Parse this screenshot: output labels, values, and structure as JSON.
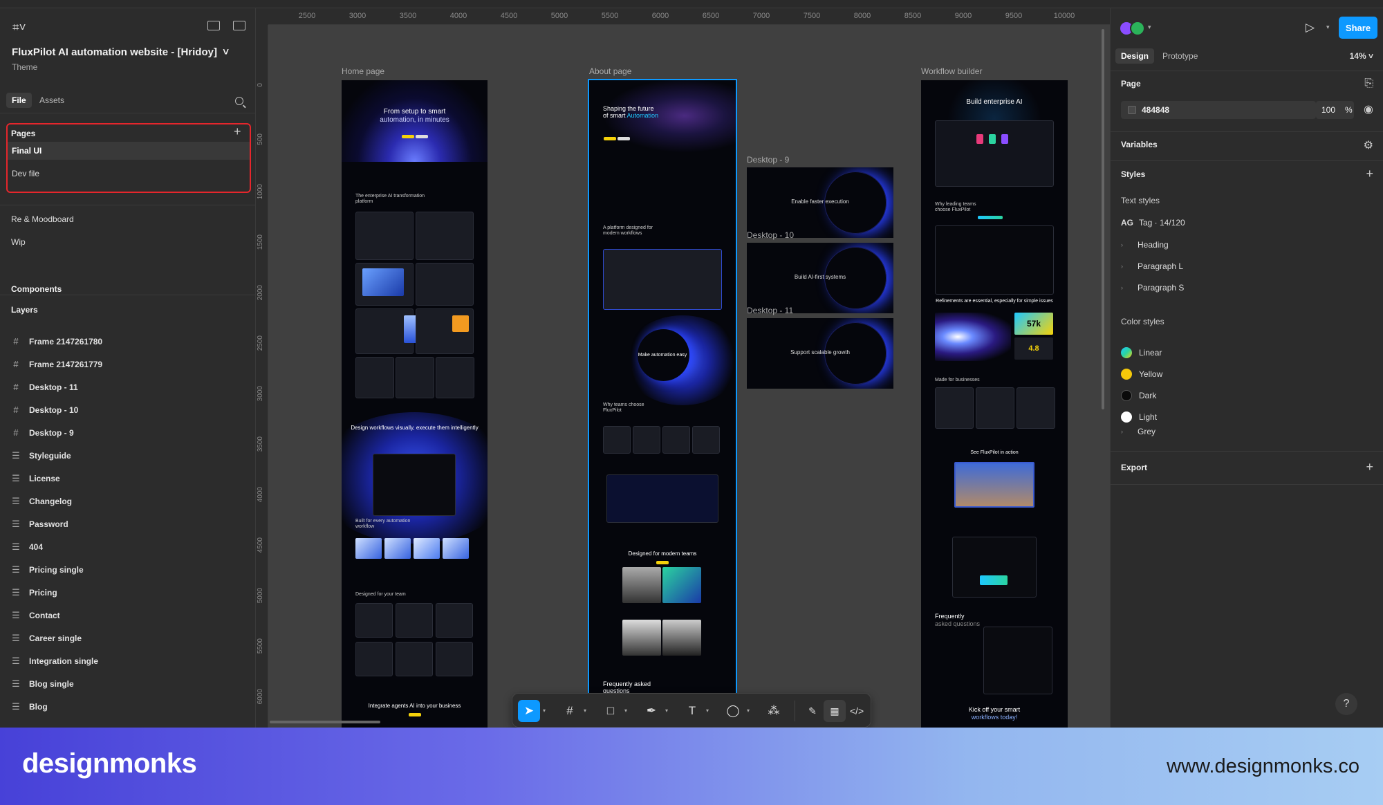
{
  "file": {
    "title": "FluxPilot AI automation website - [Hridoy]",
    "subtitle": "Theme",
    "tabs": [
      "File",
      "Assets"
    ]
  },
  "pages": {
    "label": "Pages",
    "items": [
      "Final UI",
      "Dev file"
    ],
    "others": [
      "Re & Moodboard",
      "Wip"
    ]
  },
  "sidebar": {
    "components_label": "Components",
    "layers_label": "Layers",
    "layers": [
      {
        "icon": "frame-icon",
        "glyph": "#",
        "label": "Frame 2147261780"
      },
      {
        "icon": "frame-icon",
        "glyph": "#",
        "label": "Frame 2147261779"
      },
      {
        "icon": "frame-icon",
        "glyph": "#",
        "label": "Desktop - 11"
      },
      {
        "icon": "frame-icon",
        "glyph": "#",
        "label": "Desktop - 10"
      },
      {
        "icon": "frame-icon",
        "glyph": "#",
        "label": "Desktop - 9"
      },
      {
        "icon": "section-icon",
        "glyph": "☰",
        "label": "Styleguide"
      },
      {
        "icon": "section-icon",
        "glyph": "☰",
        "label": "License"
      },
      {
        "icon": "section-icon",
        "glyph": "☰",
        "label": "Changelog"
      },
      {
        "icon": "section-icon",
        "glyph": "☰",
        "label": "Password"
      },
      {
        "icon": "section-icon",
        "glyph": "☰",
        "label": "404"
      },
      {
        "icon": "section-icon",
        "glyph": "☰",
        "label": "Pricing single"
      },
      {
        "icon": "section-icon",
        "glyph": "☰",
        "label": "Pricing"
      },
      {
        "icon": "section-icon",
        "glyph": "☰",
        "label": "Contact"
      },
      {
        "icon": "section-icon",
        "glyph": "☰",
        "label": "Career single"
      },
      {
        "icon": "section-icon",
        "glyph": "☰",
        "label": "Integration single"
      },
      {
        "icon": "section-icon",
        "glyph": "☰",
        "label": "Blog single"
      },
      {
        "icon": "section-icon",
        "glyph": "☰",
        "label": "Blog"
      }
    ]
  },
  "ruler": {
    "top": [
      "2500",
      "3000",
      "3500",
      "4000",
      "4500",
      "5000",
      "5500",
      "6000",
      "6500",
      "7000",
      "7500",
      "8000",
      "8500",
      "9000",
      "9500",
      "10000"
    ],
    "left": [
      "0",
      "500",
      "1000",
      "1500",
      "2000",
      "2500",
      "3000",
      "3500",
      "4000",
      "4500",
      "5000",
      "5500",
      "6000"
    ]
  },
  "canvas": {
    "frames": {
      "home": {
        "label": "Home page",
        "hero_title": "From setup to smart",
        "hero_title2": "automation, in minutes",
        "section1": "The enterprise AI transformation platform",
        "section2": "Design workflows visually, execute them intelligently",
        "section3": "Built for every automation workflow",
        "section4": "Designed for your team",
        "section5": "Integrate agents AI into your business"
      },
      "about": {
        "label": "About page",
        "hero_title": "Shaping the future",
        "hero_title_a": "of smart ",
        "hero_title_b": "Automation",
        "section1": "A platform designed for modern workflows",
        "orb_text": "Make automation easy",
        "section2": "Why teams choose FluxPilot",
        "section3": "Designed for modern teams",
        "section4": "Frequently asked questions"
      },
      "workflow": {
        "label": "Workflow builder",
        "hero_title": "Build enterprise AI",
        "section1": "Why leading teams choose FluxPilot",
        "section2": "Refinements are essential, especially for simple issues",
        "stat1": "57k",
        "stat2": "4.8",
        "section3": "Made for businesses",
        "section4": "See FluxPilot in action",
        "faq1": "Frequently",
        "faq2": "asked questions",
        "cta1": "Kick off your smart",
        "cta2": "workflows today!"
      },
      "desktops": [
        {
          "label": "Desktop - 9",
          "text": "Enable faster execution"
        },
        {
          "label": "Desktop - 10",
          "text": "Build AI-first systems"
        },
        {
          "label": "Desktop - 11",
          "text": "Support scalable growth"
        }
      ]
    }
  },
  "toolbar": {
    "tools": [
      {
        "name": "move-tool",
        "glyph": "➤"
      },
      {
        "name": "frame-tool",
        "glyph": "#"
      },
      {
        "name": "rectangle-tool",
        "glyph": "□"
      },
      {
        "name": "pen-tool",
        "glyph": "✒"
      },
      {
        "name": "text-tool",
        "glyph": "T"
      },
      {
        "name": "comment-tool",
        "glyph": "◯"
      },
      {
        "name": "actions-tool",
        "glyph": "⁂"
      }
    ],
    "right_tools": [
      {
        "name": "draw-mode",
        "glyph": "✎"
      },
      {
        "name": "design-mode",
        "glyph": "▦"
      },
      {
        "name": "dev-mode",
        "glyph": "</>"
      }
    ]
  },
  "right": {
    "share_label": "Share",
    "tabs": [
      "Design",
      "Prototype"
    ],
    "zoom": "14%",
    "page_label": "Page",
    "page_color": "484848",
    "page_opacity": "100",
    "page_opacity_unit": "%",
    "variables_label": "Variables",
    "styles_label": "Styles",
    "text_styles_label": "Text styles",
    "text_styles_first_prefix": "AG",
    "text_styles_first": "Tag · 14/120",
    "text_styles": [
      "Heading",
      "Paragraph L",
      "Paragraph S"
    ],
    "color_styles_label": "Color styles",
    "color_styles": [
      {
        "label": "Linear",
        "color": "gradient"
      },
      {
        "label": "Yellow",
        "color": "#f5c90a"
      },
      {
        "label": "Dark",
        "color": "#0a0a0a"
      },
      {
        "label": "Light",
        "color": "#ffffff"
      }
    ],
    "color_group": "Grey",
    "export_label": "Export",
    "help": "?"
  },
  "banner": {
    "brand": "designmonks",
    "url": "www.designmonks.co"
  }
}
